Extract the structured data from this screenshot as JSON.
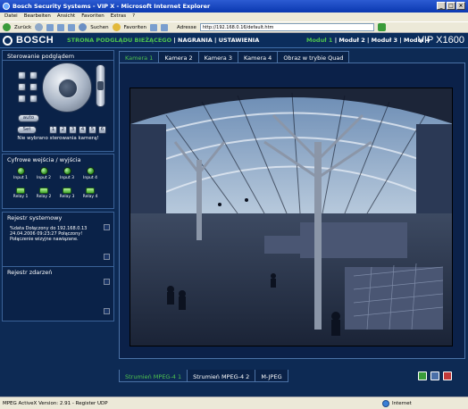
{
  "window": {
    "title": "Bosch Security Systems - VIP X - Microsoft Internet Explorer",
    "controls": [
      "_",
      "□",
      "×"
    ]
  },
  "menubar": [
    "Datei",
    "Bearbeiten",
    "Ansicht",
    "Favoriten",
    "Extras",
    "?"
  ],
  "toolbar": {
    "back_label": "Zurück",
    "search_label": "Suchen",
    "favorites_label": "Favoriten",
    "address_label": "Adresse",
    "address_value": "http://192.168.0.16/default.htm"
  },
  "app": {
    "logo": "BOSCH",
    "nav": [
      "STRONA PODGLĄDU BIEŻĄCEGO",
      "NAGRANIA",
      "USTAWIENIA"
    ],
    "nav_active_index": 0,
    "modules": [
      "Moduł 1",
      "Moduł 2",
      "Moduł 3",
      "Moduł 4"
    ],
    "module_active_index": 0,
    "product": "VIP X1600",
    "accent_color": "#4ec24e",
    "background_color": "#0d2a54"
  },
  "ptz": {
    "title": "Sterowanie podglądem",
    "auto_label": "auto",
    "set_label": "Set",
    "presets": [
      "1",
      "2",
      "3",
      "4",
      "5",
      "6"
    ],
    "note": "Nie wybrano sterowania kamerą!"
  },
  "io": {
    "title": "Cyfrowe wejścia / wyjścia",
    "inputs": [
      "Input 1",
      "Input 2",
      "Input 3",
      "Input 4"
    ],
    "relays": [
      "Relay 1",
      "Relay 2",
      "Relay 3",
      "Relay 4"
    ]
  },
  "system_log": {
    "title": "Rejestr systemowy",
    "lines": [
      "%data Dołączony do 192.168.0.13",
      "24.04.2006 09:23:27 Połączony!",
      "Połączenie wizyjne nawiązane."
    ]
  },
  "event_log": {
    "title": "Rejestr zdarzeń"
  },
  "camera_tabs": [
    "Kamera 1",
    "Kamera 2",
    "Kamera 3",
    "Kamera 4",
    "Obraz w trybie Quad"
  ],
  "camera_tab_active_index": 0,
  "stream_tabs": [
    "Strumień MPEG-4 1",
    "Strumień MPEG-4 2",
    "M-JPEG"
  ],
  "stream_tab_active_index": 0,
  "statusbar": {
    "left": "MPEG ActiveX Version: 2.91 - Register UDP",
    "zone": "Internet"
  }
}
